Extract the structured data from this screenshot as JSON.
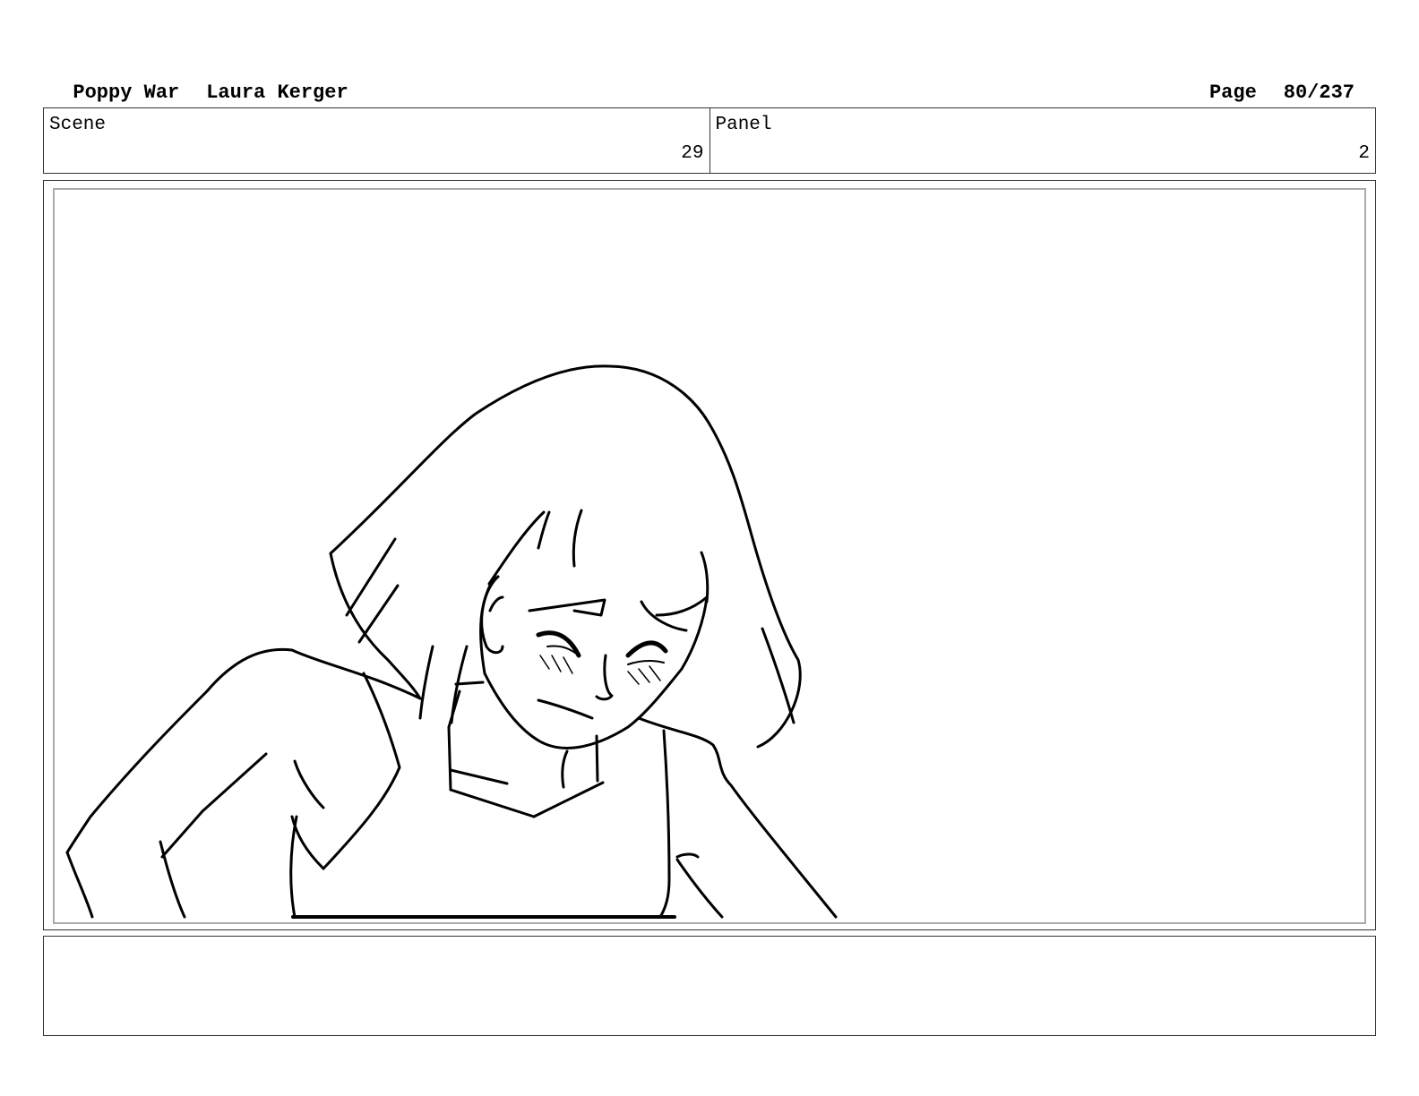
{
  "header": {
    "project": "Poppy War",
    "author": "Laura Kerger",
    "page_label": "Page",
    "page_number": "80/237"
  },
  "scene": {
    "label": "Scene",
    "value": "29"
  },
  "panel": {
    "label": "Panel",
    "value": "2"
  },
  "notes": {
    "text": ""
  },
  "drawing": {
    "stroke_color": "#000000",
    "frame_border_color": "#aaaaaa"
  }
}
